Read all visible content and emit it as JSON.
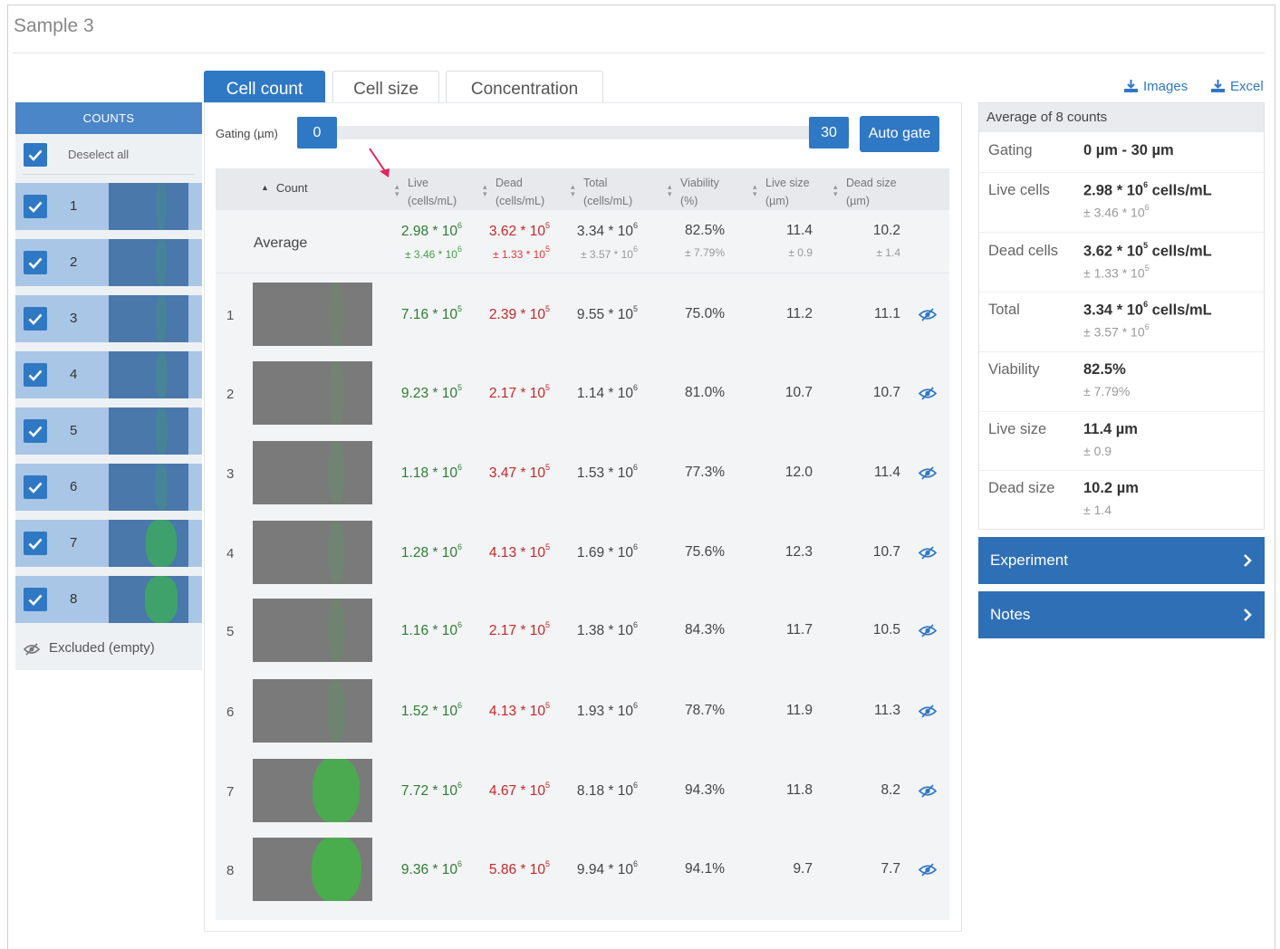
{
  "page": {
    "title": "Sample 3"
  },
  "counts_panel": {
    "header": "COUNTS",
    "deselect_label": "Deselect all",
    "items": [
      {
        "label": "1",
        "checked": true
      },
      {
        "label": "2",
        "checked": true
      },
      {
        "label": "3",
        "checked": true
      },
      {
        "label": "4",
        "checked": true
      },
      {
        "label": "5",
        "checked": true
      },
      {
        "label": "6",
        "checked": true
      },
      {
        "label": "7",
        "checked": true
      },
      {
        "label": "8",
        "checked": true
      }
    ],
    "excluded_label": "Excluded (empty)"
  },
  "tabs": [
    {
      "label": "Cell count",
      "active": true
    },
    {
      "label": "Cell size",
      "active": false
    },
    {
      "label": "Concentration",
      "active": false
    }
  ],
  "gating": {
    "label": "Gating (µm)",
    "min_label": "0",
    "max_label": "30",
    "auto_gate_label": "Auto gate"
  },
  "table": {
    "headers": {
      "count": "Count",
      "live_1": "Live",
      "live_2": "(cells/mL)",
      "dead_1": "Dead",
      "dead_2": "(cells/mL)",
      "total_1": "Total",
      "total_2": "(cells/mL)",
      "viability_1": "Viability",
      "viability_2": "(%)",
      "livesize_1": "Live size",
      "livesize_2": "(µm)",
      "deadsize_1": "Dead size",
      "deadsize_2": "(µm)"
    },
    "average": {
      "label": "Average",
      "live": "2.98 * 10",
      "live_exp": "6",
      "live_sd": "± 3.46 * 10",
      "live_sd_exp": "6",
      "dead": "3.62 * 10",
      "dead_exp": "5",
      "dead_sd": "± 1.33 * 10",
      "dead_sd_exp": "5",
      "total": "3.34 * 10",
      "total_exp": "6",
      "total_sd": "± 3.57 * 10",
      "total_sd_exp": "6",
      "viability": "82.5%",
      "viability_sd": "± 7.79%",
      "live_size": "11.4",
      "live_size_sd": "± 0.9",
      "dead_size": "10.2",
      "dead_size_sd": "± 1.4"
    },
    "rows": [
      {
        "idx": "1",
        "live": "7.16 * 10",
        "live_exp": "5",
        "dead": "2.39 * 10",
        "dead_exp": "5",
        "total": "9.55 * 10",
        "total_exp": "5",
        "viability": "75.0%",
        "live_size": "11.2",
        "dead_size": "11.1",
        "green_level": 0.05
      },
      {
        "idx": "2",
        "live": "9.23 * 10",
        "live_exp": "5",
        "dead": "2.17 * 10",
        "dead_exp": "5",
        "total": "1.14 * 10",
        "total_exp": "6",
        "viability": "81.0%",
        "live_size": "10.7",
        "dead_size": "10.7",
        "green_level": 0.06
      },
      {
        "idx": "3",
        "live": "1.18 * 10",
        "live_exp": "6",
        "dead": "3.47 * 10",
        "dead_exp": "5",
        "total": "1.53 * 10",
        "total_exp": "6",
        "viability": "77.3%",
        "live_size": "12.0",
        "dead_size": "11.4",
        "green_level": 0.08
      },
      {
        "idx": "4",
        "live": "1.28 * 10",
        "live_exp": "6",
        "dead": "4.13 * 10",
        "dead_exp": "5",
        "total": "1.69 * 10",
        "total_exp": "6",
        "viability": "75.6%",
        "live_size": "12.3",
        "dead_size": "10.7",
        "green_level": 0.09
      },
      {
        "idx": "5",
        "live": "1.16 * 10",
        "live_exp": "6",
        "dead": "2.17 * 10",
        "dead_exp": "5",
        "total": "1.38 * 10",
        "total_exp": "6",
        "viability": "84.3%",
        "live_size": "11.7",
        "dead_size": "10.5",
        "green_level": 0.1
      },
      {
        "idx": "6",
        "live": "1.52 * 10",
        "live_exp": "6",
        "dead": "4.13 * 10",
        "dead_exp": "5",
        "total": "1.93 * 10",
        "total_exp": "6",
        "viability": "78.7%",
        "live_size": "11.9",
        "dead_size": "11.3",
        "green_level": 0.12
      },
      {
        "idx": "7",
        "live": "7.72 * 10",
        "live_exp": "6",
        "dead": "4.67 * 10",
        "dead_exp": "5",
        "total": "8.18 * 10",
        "total_exp": "6",
        "viability": "94.3%",
        "live_size": "11.8",
        "dead_size": "8.2",
        "green_level": 0.8
      },
      {
        "idx": "8",
        "live": "9.36 * 10",
        "live_exp": "6",
        "dead": "5.86 * 10",
        "dead_exp": "5",
        "total": "9.94 * 10",
        "total_exp": "6",
        "viability": "94.1%",
        "live_size": "9.7",
        "dead_size": "7.7",
        "green_level": 0.85
      }
    ]
  },
  "downloads": {
    "images_label": "Images",
    "excel_label": "Excel"
  },
  "summary": {
    "header": "Average of 8 counts",
    "gating_label": "Gating",
    "gating_value": "0 µm - 30 µm",
    "live_label": "Live cells",
    "live_value": "2.98 * 10",
    "live_exp": "6",
    "live_unit": " cells/mL",
    "live_sd": "± 3.46 * 10",
    "live_sd_exp": "6",
    "dead_label": "Dead cells",
    "dead_value": "3.62 * 10",
    "dead_exp": "5",
    "dead_unit": " cells/mL",
    "dead_sd": "± 1.33 * 10",
    "dead_sd_exp": "5",
    "total_label": "Total",
    "total_value": "3.34 * 10",
    "total_exp": "6",
    "total_unit": " cells/mL",
    "total_sd": "± 3.57 * 10",
    "total_sd_exp": "6",
    "viability_label": "Viability",
    "viability_value": "82.5%",
    "viability_sd": "± 7.79%",
    "livesize_label": "Live size",
    "livesize_value": "11.4 µm",
    "livesize_sd": "± 0.9",
    "deadsize_label": "Dead size",
    "deadsize_value": "10.2 µm",
    "deadsize_sd": "± 1.4"
  },
  "panels": {
    "experiment_label": "Experiment",
    "notes_label": "Notes"
  },
  "colors": {
    "accent": "#2f78c4",
    "live": "#2e7d32",
    "dead": "#c62828",
    "spray": "#34c23a"
  }
}
